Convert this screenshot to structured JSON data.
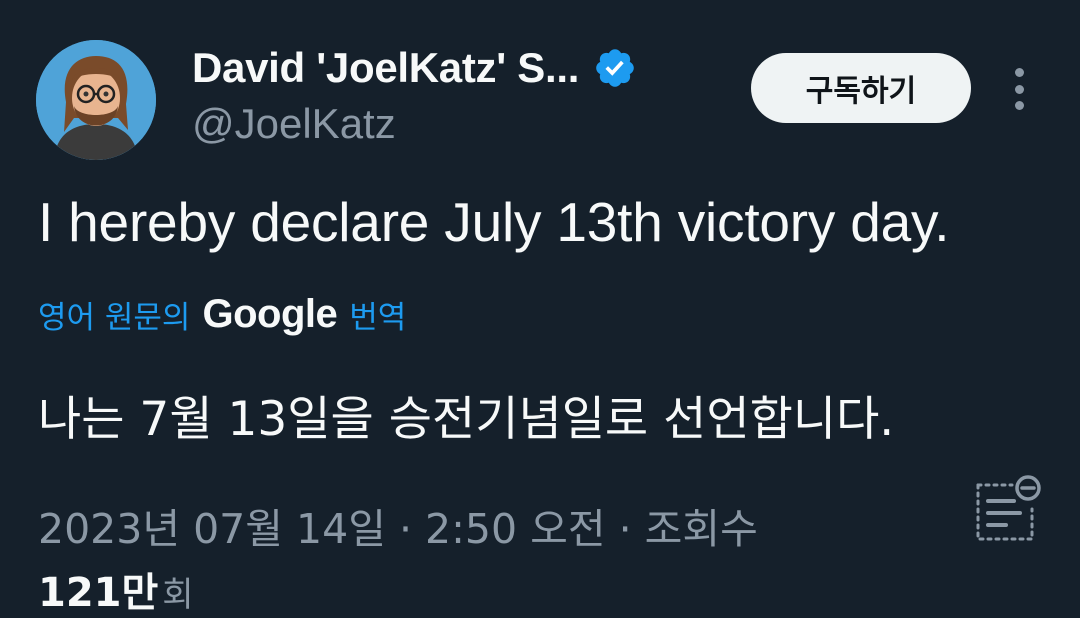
{
  "author": {
    "display_name": "David 'JoelKatz' S...",
    "handle": "@JoelKatz",
    "verified": true
  },
  "actions": {
    "subscribe_label": "구독하기",
    "more_icon": "more-vertical-icon"
  },
  "tweet": {
    "text": "I hereby declare July 13th victory day.",
    "translate_prefix": "영어 원문의",
    "translate_brand": "Google",
    "translate_suffix": "번역",
    "translated_text": "나는 7월 13일을 승전기념일로 선언합니다.",
    "timestamp": "2023년 07월 14일 · 2:50 오전 · 조회수",
    "views_count": "121만",
    "views_label": "회"
  },
  "colors": {
    "background": "#15202b",
    "link": "#1d9bf0",
    "secondary_text": "#8b98a5",
    "button_bg": "#eff3f4"
  }
}
